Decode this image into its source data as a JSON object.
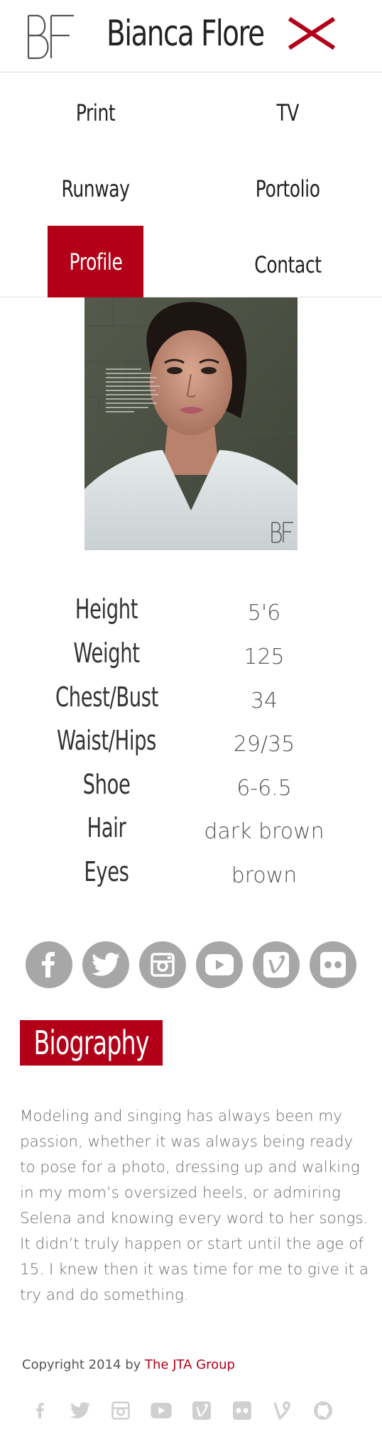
{
  "header": {
    "brand": "Bianca Flore",
    "logo_letters": "BF",
    "close_icon": "close-x-icon",
    "accent_color": "#b20018"
  },
  "nav": {
    "items": [
      {
        "label": "Print",
        "active": false
      },
      {
        "label": "TV",
        "active": false
      },
      {
        "label": "Runway",
        "active": false
      },
      {
        "label": "Portolio",
        "active": false
      },
      {
        "label": "Profile",
        "active": true
      },
      {
        "label": "Contact",
        "active": false
      }
    ]
  },
  "profile": {
    "photo": "portrait-photo",
    "photo_watermark": "BF"
  },
  "stats": [
    {
      "label": "Height",
      "value": "5'6"
    },
    {
      "label": "Weight",
      "value": "125"
    },
    {
      "label": "Chest/Bust",
      "value": "34"
    },
    {
      "label": "Waist/Hips",
      "value": "29/35"
    },
    {
      "label": "Shoe",
      "value": "6-6.5"
    },
    {
      "label": "Hair",
      "value": "dark brown"
    },
    {
      "label": "Eyes",
      "value": "brown"
    }
  ],
  "socials": [
    {
      "name": "facebook-icon"
    },
    {
      "name": "twitter-icon"
    },
    {
      "name": "instagram-icon"
    },
    {
      "name": "youtube-icon"
    },
    {
      "name": "vimeo-icon"
    },
    {
      "name": "flickr-icon"
    }
  ],
  "biography": {
    "heading": "Biography",
    "text": "Modeling and singing has always been my passion, whether it was always being ready to pose for a photo, dressing up and walking in my mom’s oversized heels, or admiring Selena and knowing every word to her songs. It didn’t truly happen or start until the age of 15. I knew then it was time for me to give it a try and do something."
  },
  "footer": {
    "copyright_prefix": "Copyright 2014 by ",
    "copyright_link": "The JTA Group",
    "icons": [
      "facebook-icon",
      "twitter-icon",
      "instagram-icon",
      "youtube-icon",
      "vimeo-icon",
      "flickr-icon",
      "vine-icon",
      "github-icon"
    ]
  }
}
